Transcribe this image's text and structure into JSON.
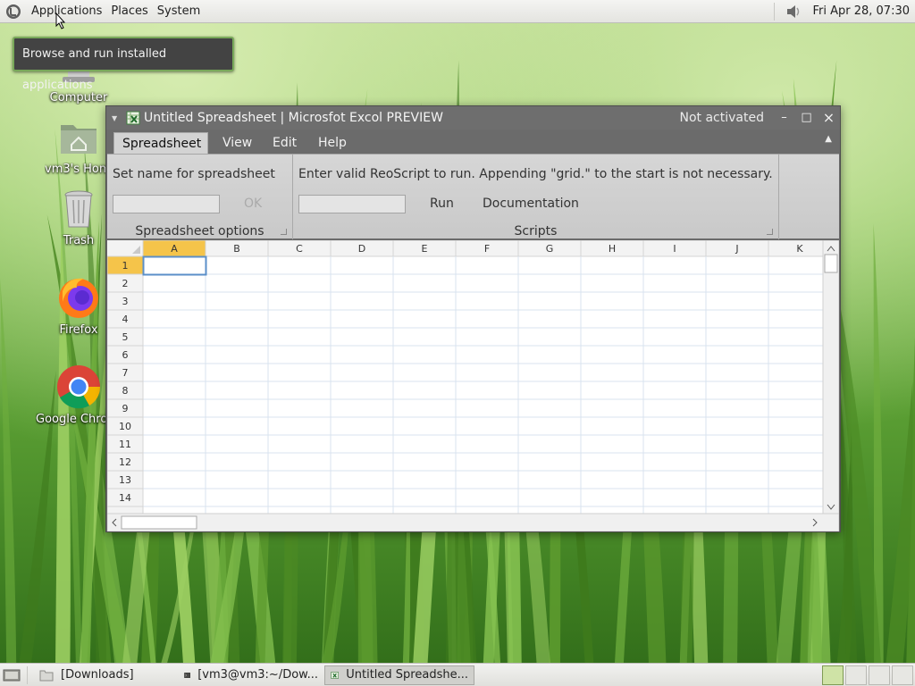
{
  "top_panel": {
    "menus": [
      "Applications",
      "Places",
      "System"
    ],
    "clock": "Fri Apr 28, 07:30",
    "tooltip": "Browse and run installed applications"
  },
  "desktop": {
    "icons": [
      {
        "label": "Computer",
        "icon": "computer-icon"
      },
      {
        "label": "vm3's Home",
        "icon": "home-folder-icon"
      },
      {
        "label": "Trash",
        "icon": "trash-icon"
      },
      {
        "label": "Firefox",
        "icon": "firefox-icon"
      },
      {
        "label": "Google Chrome",
        "icon": "chrome-icon"
      }
    ]
  },
  "window": {
    "title": "Untitled Spreadsheet | Microsfot Excol PREVIEW",
    "status": "Not activated",
    "controls": {
      "minimize": "–",
      "maximize": "□",
      "close": "×"
    },
    "tabs": [
      "Spreadsheet",
      "View",
      "Edit",
      "Help"
    ],
    "active_tab": "Spreadsheet",
    "ribbon": {
      "options_group": {
        "prompt": "Set name for spreadsheet",
        "name_value": "",
        "ok_label": "OK",
        "title": "Spreadsheet options"
      },
      "scripts_group": {
        "prompt": "Enter valid ReoScript to run. Appending \"grid.\" to the start is not necessary.",
        "script_value": "",
        "run_label": "Run",
        "docs_label": "Documentation",
        "title": "Scripts"
      }
    },
    "sheet": {
      "columns": [
        "A",
        "B",
        "C",
        "D",
        "E",
        "F",
        "G",
        "H",
        "I",
        "J",
        "K"
      ],
      "rows": [
        "1",
        "2",
        "3",
        "4",
        "5",
        "6",
        "7",
        "8",
        "9",
        "10",
        "11",
        "12",
        "13",
        "14"
      ],
      "selected_cell": "A1"
    }
  },
  "taskbar": {
    "items": [
      {
        "label": "[Downloads]",
        "icon": "folder-icon"
      },
      {
        "label": "[vm3@vm3:~/Dow...",
        "icon": "terminal-icon"
      },
      {
        "label": "Untitled Spreadshe...",
        "icon": "spreadsheet-icon"
      }
    ],
    "active_index": 2
  },
  "colors": {
    "panel": "#e8e8e4",
    "window_chrome": "#6b6b6b",
    "ribbon": "#d0d0d0",
    "selected_header": "#f5c44a",
    "grid_line": "#d9e3ef",
    "selection_border": "#5b8fc9"
  }
}
